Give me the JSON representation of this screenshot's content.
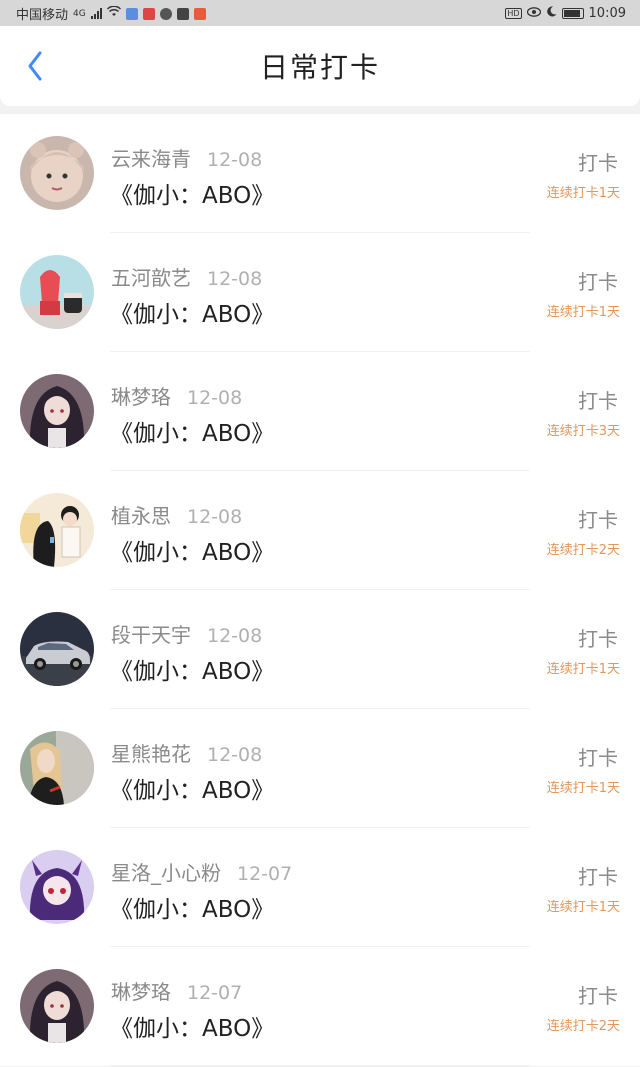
{
  "status": {
    "carrier": "中国移动",
    "network": "4G",
    "time": "10:09"
  },
  "header": {
    "title": "日常打卡"
  },
  "checkin_label": "打卡",
  "items": [
    {
      "name": "云来海青",
      "date": "12-08",
      "book": "《伽小：ABO》",
      "streak": "连续打卡1天",
      "avatar": "child-bear-hat"
    },
    {
      "name": "五河歆艺",
      "date": "12-08",
      "book": "《伽小：ABO》",
      "streak": "连续打卡1天",
      "avatar": "dessert-cup"
    },
    {
      "name": "琳梦珞",
      "date": "12-08",
      "book": "《伽小：ABO》",
      "streak": "连续打卡3天",
      "avatar": "anime-girl-dark"
    },
    {
      "name": "植永思",
      "date": "12-08",
      "book": "《伽小：ABO》",
      "streak": "连续打卡2天",
      "avatar": "illustrated-couple"
    },
    {
      "name": "段干天宇",
      "date": "12-08",
      "book": "《伽小：ABO》",
      "streak": "连续打卡1天",
      "avatar": "silver-car"
    },
    {
      "name": "星熊艳花",
      "date": "12-08",
      "book": "《伽小：ABO》",
      "streak": "连续打卡1天",
      "avatar": "woman-portrait"
    },
    {
      "name": "星洛_小心粉",
      "date": "12-07",
      "book": "《伽小：ABO》",
      "streak": "连续打卡1天",
      "avatar": "anime-purple-cat-ears"
    },
    {
      "name": "琳梦珞",
      "date": "12-07",
      "book": "《伽小：ABO》",
      "streak": "连续打卡2天",
      "avatar": "anime-girl-dark"
    }
  ],
  "colors": {
    "accent_blue": "#3d8bff",
    "streak_orange": "#e3975b"
  }
}
